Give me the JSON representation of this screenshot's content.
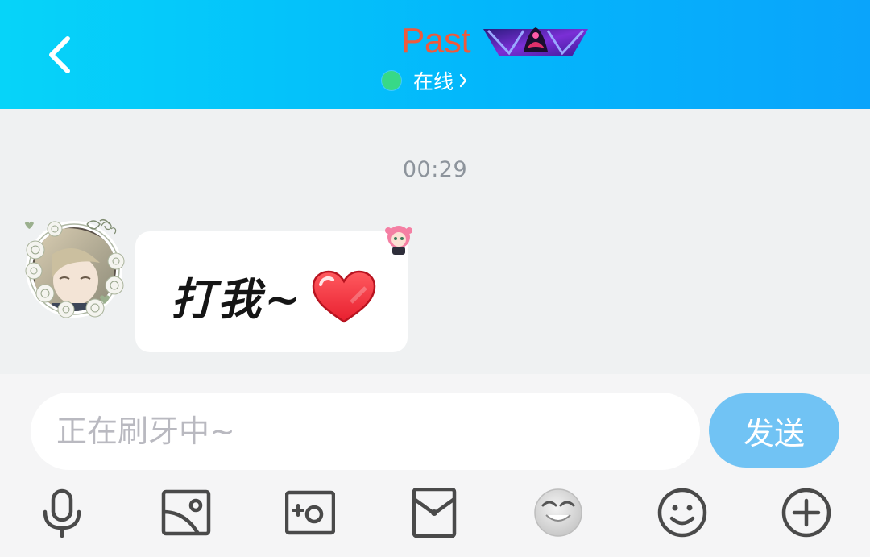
{
  "header": {
    "contact_name": "Past",
    "status_text": "在线",
    "back_icon": "chevron-left-icon",
    "vip_badge_icon": "vip-badge-icon"
  },
  "chat": {
    "timestamp": "00:29",
    "messages": [
      {
        "sender": "contact",
        "text": "打我~",
        "emoji": "red-heart"
      }
    ]
  },
  "input": {
    "placeholder": "正在刷牙中~",
    "value": "",
    "send_label": "发送"
  },
  "toolbar": {
    "items": [
      "microphone-icon",
      "image-icon",
      "camera-icon",
      "red-packet-icon",
      "sticker-face-icon",
      "emoji-icon",
      "plus-icon"
    ]
  },
  "colors": {
    "header_gradient_start": "#06d4f9",
    "header_gradient_end": "#0aa4fb",
    "name_color": "#ee5a3c",
    "online_dot": "#37d987",
    "send_button": "#71c3f4",
    "chat_bg": "#eff1f2"
  }
}
